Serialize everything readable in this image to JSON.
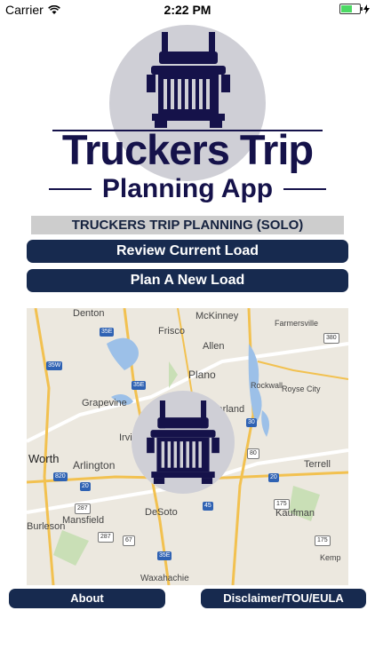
{
  "status_bar": {
    "carrier": "Carrier",
    "time": "2:22 PM",
    "battery_level": 0.6
  },
  "logo": {
    "title": "Truckers Trip",
    "subtitle": "Planning App"
  },
  "heading": "TRUCKERS TRIP PLANNING (SOLO)",
  "buttons": {
    "review": "Review Current Load",
    "plan": "Plan A New Load",
    "about": "About",
    "disclaimer": "Disclaimer/TOU/EULA"
  },
  "map": {
    "places": [
      "Denton",
      "McKinney",
      "Farmersville",
      "Frisco",
      "Allen",
      "Plano",
      "Royse City",
      "Grapevine",
      "Irving",
      "Garland",
      "Worth",
      "Arlington",
      "Terrell",
      "Mansfield",
      "DeSoto",
      "Kaufman",
      "Burleson",
      "Kemp",
      "Waxahachie",
      "Rockwall"
    ],
    "shields": [
      "35E",
      "35W",
      "380",
      "35E",
      "30",
      "820",
      "20",
      "80",
      "20",
      "287",
      "175",
      "287",
      "67",
      "45",
      "175",
      "35E"
    ]
  },
  "colors": {
    "navy": "#172a4f",
    "logo_navy": "#15124a",
    "heading_bg": "#cdcdcd",
    "logo_circle": "#cfcfd6"
  }
}
